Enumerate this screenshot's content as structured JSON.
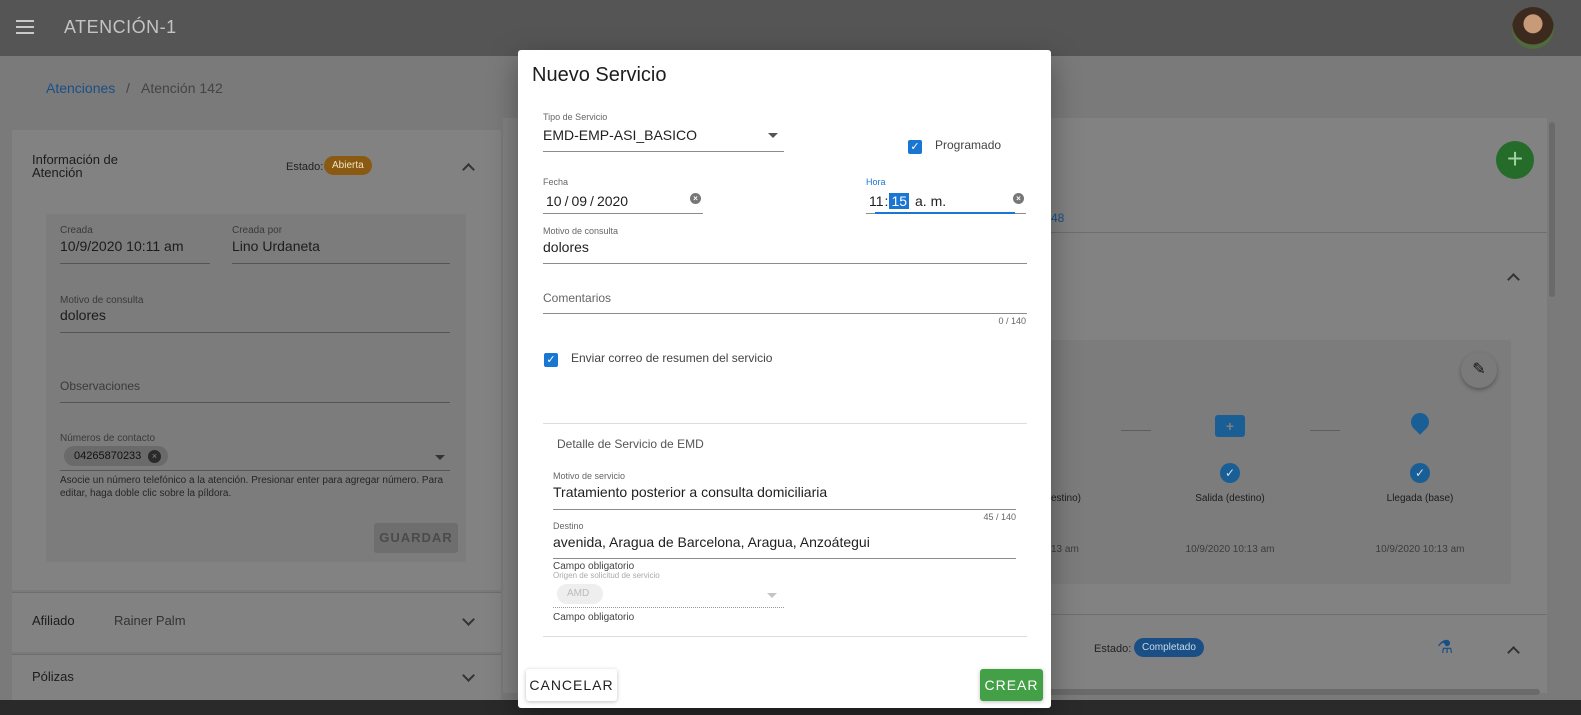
{
  "app": {
    "title": "ATENCIÓN-1",
    "menu_icon": "menu-icon",
    "avatar_icon": "avatar"
  },
  "breadcrumb": {
    "root": "Atenciones",
    "separator": "/",
    "current": "Atención 142"
  },
  "info_panel": {
    "title": "Información de Atención",
    "estado_label": "Estado:",
    "estado_value": "Abierta",
    "estado_color": "#c77d10",
    "creada_label": "Creada",
    "creada_value": "10/9/2020 10:11 am",
    "creada_por_label": "Creada por",
    "creada_por_value": "Lino Urdaneta",
    "motivo_label": "Motivo de consulta",
    "motivo_value": "dolores",
    "observaciones_placeholder": "Observaciones",
    "contactos_label": "Números de contacto",
    "contacto_chip": "04265870233",
    "contactos_hint": "Asocie un número telefónico a la atención. Presionar enter para agregar número. Para editar, haga doble clic sobre la píldora.",
    "guardar_label": "GUARDAR"
  },
  "afiliado": {
    "label": "Afiliado",
    "value": "Rainer Palm"
  },
  "polizas": {
    "label": "Pólizas"
  },
  "right_panel": {
    "link_fragment": "48",
    "steps": [
      {
        "label": "estino)",
        "date": "13 am"
      },
      {
        "label": "Salida (destino)",
        "date": "10/9/2020 10:13 am"
      },
      {
        "label": "Llegada (base)",
        "date": "10/9/2020 10:13 am"
      }
    ],
    "estado_label": "Estado:",
    "estado_value": "Completado",
    "estado_color": "#1a5e96"
  },
  "dialog": {
    "title": "Nuevo Servicio",
    "tipo_servicio_label": "Tipo de Servicio",
    "tipo_servicio_value": "EMD-EMP-ASI_BASICO",
    "programado_label": "Programado",
    "programado_checked": true,
    "fecha_label": "Fecha",
    "fecha_day": "10",
    "fecha_month": "09",
    "fecha_year": "2020",
    "date_sep": "/",
    "hora_label": "Hora",
    "hora_hour": "11",
    "hora_sep": ":",
    "hora_minute": "15",
    "hora_ampm": "a. m.",
    "motivo_label": "Motivo de consulta",
    "motivo_value": "dolores",
    "comentarios_placeholder": "Comentarios",
    "comentarios_counter": "0 / 140",
    "enviar_correo_label": "Enviar correo de resumen del servicio",
    "enviar_correo_checked": true,
    "detalle_title": "Detalle de Servicio de EMD",
    "motivo_servicio_label": "Motivo de servicio",
    "motivo_servicio_value": "Tratamiento posterior a consulta domiciliaria",
    "motivo_servicio_counter": "45 / 140",
    "destino_label": "Destino",
    "destino_value": "avenida, Aragua de Barcelona, Aragua, Anzoátegui",
    "destino_hint": "Campo obligatorio",
    "origen_label": "Origen de solicitud de servicio",
    "origen_chip": "AMD",
    "origen_hint": "Campo obligatorio",
    "cancel_label": "CANCELAR",
    "create_label": "CREAR",
    "accent_color": "#1976d2",
    "create_color": "#43a047"
  }
}
